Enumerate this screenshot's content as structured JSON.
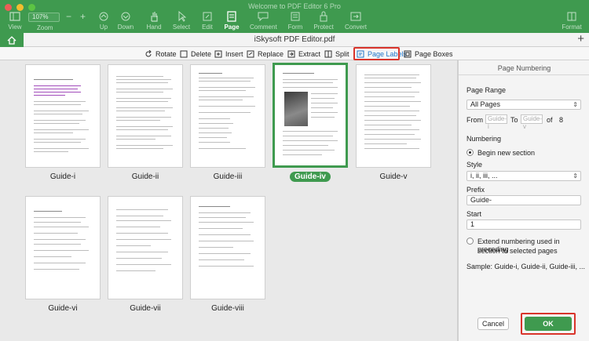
{
  "window": {
    "title": "Welcome to PDF Editor 6 Pro"
  },
  "toolbar": {
    "zoom_value": "107%",
    "zoom_label": "Zoom",
    "items": [
      {
        "label": "View",
        "icon": "view-icon"
      },
      {
        "label": "Up",
        "icon": "up-icon"
      },
      {
        "label": "Down",
        "icon": "down-icon"
      },
      {
        "label": "Hand",
        "icon": "hand-icon"
      },
      {
        "label": "Select",
        "icon": "select-icon"
      },
      {
        "label": "Edit",
        "icon": "edit-icon"
      },
      {
        "label": "Page",
        "icon": "page-icon"
      },
      {
        "label": "Comment",
        "icon": "comment-icon"
      },
      {
        "label": "Form",
        "icon": "form-icon"
      },
      {
        "label": "Protect",
        "icon": "protect-icon"
      },
      {
        "label": "Convert",
        "icon": "convert-icon"
      },
      {
        "label": "Format",
        "icon": "format-icon"
      }
    ],
    "accent": "#3f9a4f"
  },
  "tabbar": {
    "document_title": "iSkysoft PDF Editor.pdf"
  },
  "page_tools": [
    {
      "label": "Rotate"
    },
    {
      "label": "Delete"
    },
    {
      "label": "Insert"
    },
    {
      "label": "Replace"
    },
    {
      "label": "Extract"
    },
    {
      "label": "Split"
    },
    {
      "label": "Page Labels"
    },
    {
      "label": "Page Boxes"
    }
  ],
  "thumbnails": [
    {
      "label": "Guide-i"
    },
    {
      "label": "Guide-ii"
    },
    {
      "label": "Guide-iii"
    },
    {
      "label": "Guide-iv"
    },
    {
      "label": "Guide-v"
    },
    {
      "label": "Guide-vi"
    },
    {
      "label": "Guide-vii"
    },
    {
      "label": "Guide-viii"
    }
  ],
  "panel": {
    "title": "Page Numbering",
    "page_range_label": "Page Range",
    "page_range_value": "All Pages",
    "from_label": "From",
    "from_placeholder": "Guide-i",
    "to_label": "To",
    "to_placeholder": "Guide-v",
    "of_label": "of",
    "total_pages": "8",
    "numbering_label": "Numbering",
    "begin_new_section": "Begin new section",
    "style_label": "Style",
    "style_value": "i, ii, iii, ...",
    "prefix_label": "Prefix",
    "prefix_value": "Guide-",
    "start_label": "Start",
    "start_value": "1",
    "extend_line1": "Extend numbering used in preceding",
    "extend_line2": "section to selected pages",
    "sample": "Sample: Guide-i, Guide-ii, Guide-iii, ...",
    "cancel_label": "Cancel",
    "ok_label": "OK"
  }
}
